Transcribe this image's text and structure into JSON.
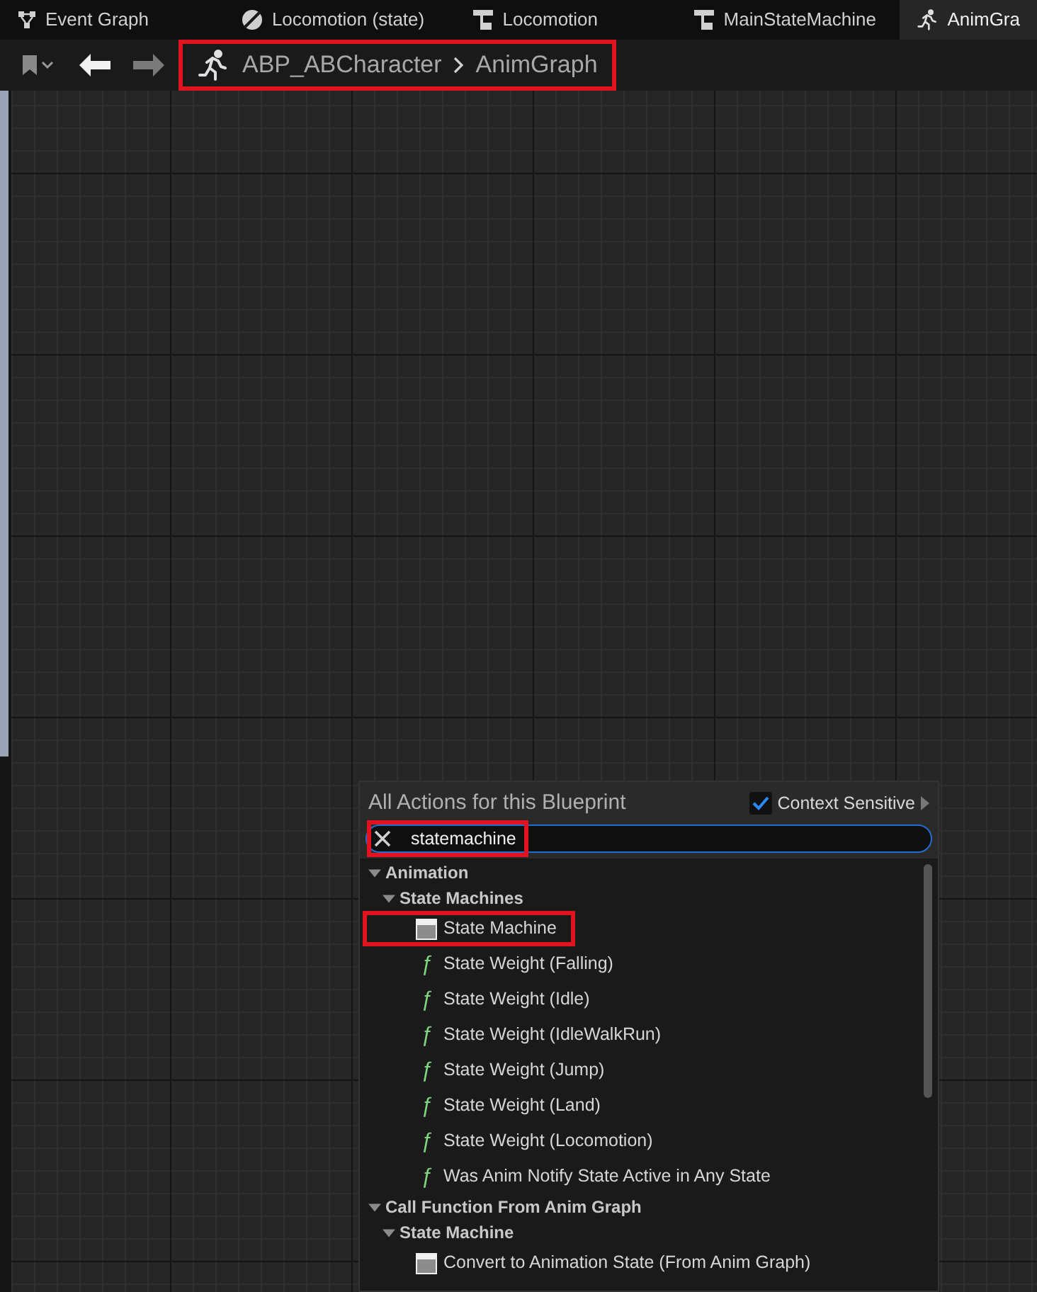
{
  "tabs": [
    {
      "label": "Event Graph",
      "kind": "graph",
      "selected": false
    },
    {
      "label": "Locomotion (state)",
      "kind": "state",
      "selected": false
    },
    {
      "label": "Locomotion",
      "kind": "machine",
      "selected": false
    },
    {
      "label": "MainStateMachine",
      "kind": "machine",
      "selected": false
    },
    {
      "label": "AnimGra",
      "kind": "anim",
      "selected": true
    }
  ],
  "breadcrumb": {
    "items": [
      "ABP_ABCharacter",
      "AnimGraph"
    ],
    "highlighted": true
  },
  "action_menu": {
    "title": "All Actions for this Blueprint",
    "context_sensitive": {
      "label": "Context Sensitive",
      "checked": true
    },
    "search": {
      "value": "statemachine",
      "highlighted": true
    },
    "tree": [
      {
        "label": "Animation",
        "kind": "category",
        "expanded": true,
        "children": [
          {
            "label": "State Machines",
            "kind": "category",
            "expanded": true,
            "children": [
              {
                "label": "State Machine",
                "kind": "node",
                "highlighted": true
              },
              {
                "label": "State Weight (Falling)",
                "kind": "function",
                "icon": "ƒ",
                "highlighted": false
              },
              {
                "label": "State Weight (Idle)",
                "kind": "function",
                "icon": "ƒ",
                "highlighted": false
              },
              {
                "label": "State Weight (IdleWalkRun)",
                "kind": "function",
                "icon": "ƒ",
                "highlighted": false
              },
              {
                "label": "State Weight (Jump)",
                "kind": "function",
                "icon": "ƒ",
                "highlighted": false
              },
              {
                "label": "State Weight (Land)",
                "kind": "function",
                "icon": "ƒ",
                "highlighted": false
              },
              {
                "label": "State Weight (Locomotion)",
                "kind": "function",
                "icon": "ƒ",
                "highlighted": false
              },
              {
                "label": "Was Anim Notify State Active in Any State",
                "kind": "function",
                "icon": "ƒ",
                "highlighted": false
              }
            ]
          }
        ]
      },
      {
        "label": "Call Function From Anim Graph",
        "kind": "category",
        "expanded": true,
        "children": [
          {
            "label": "State Machine",
            "kind": "category",
            "expanded": true,
            "children": [
              {
                "label": "Convert to Animation State (From Anim Graph)",
                "kind": "node",
                "highlighted": false
              }
            ]
          }
        ]
      }
    ]
  }
}
